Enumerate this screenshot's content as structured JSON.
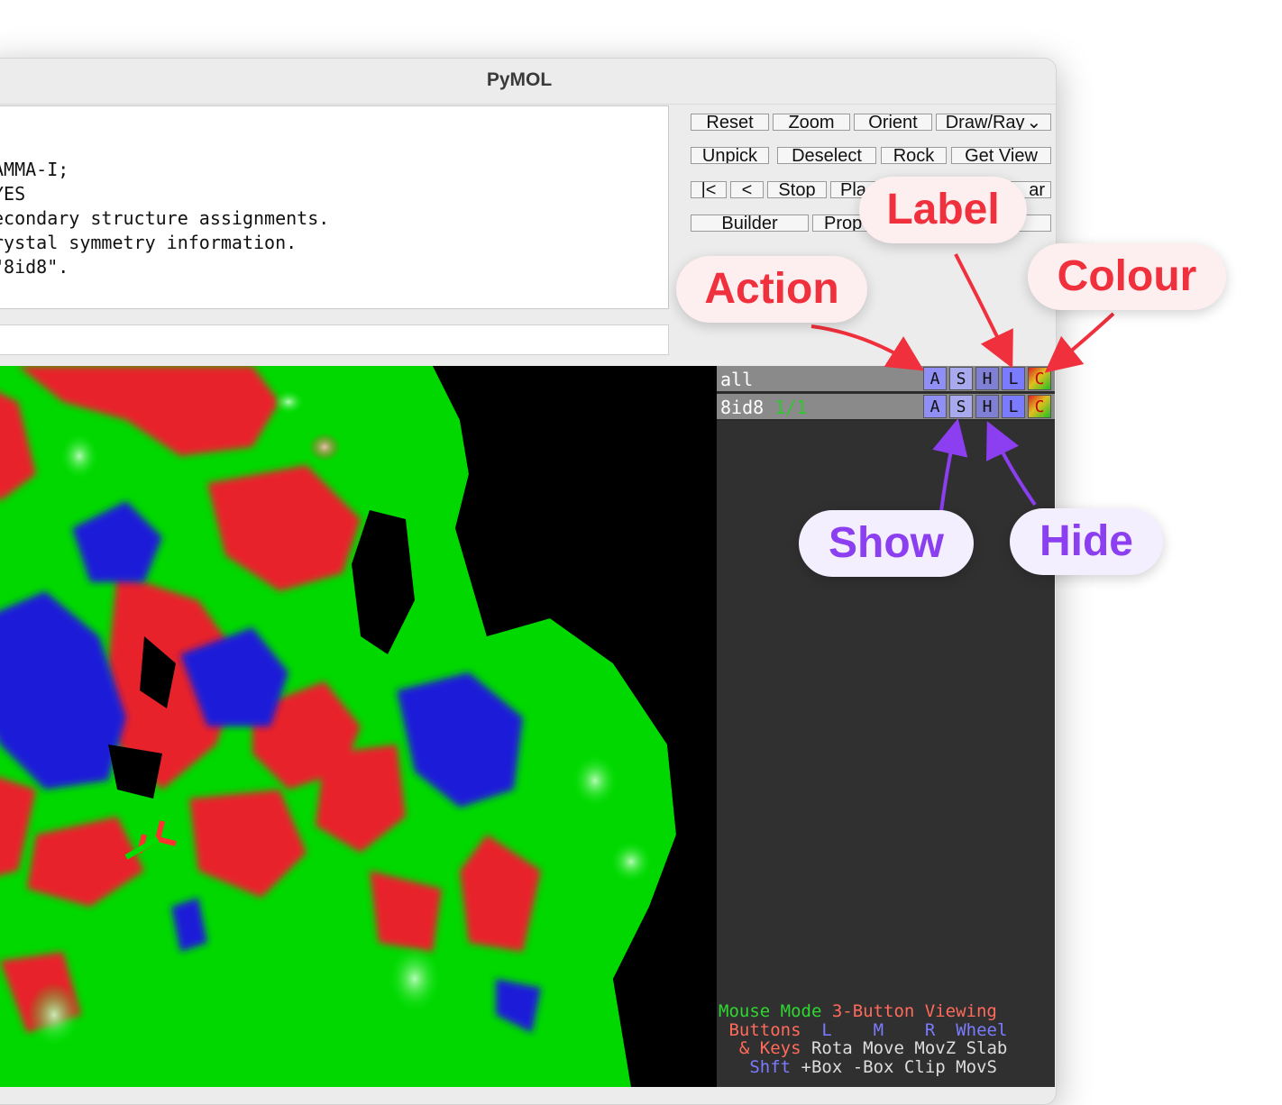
{
  "window": {
    "title": "PyMOL"
  },
  "output_lines": [
    "AMMA-I;",
    "YES",
    "econdary structure assignments.",
    "rystal symmetry information.",
    "\"8id8\"."
  ],
  "buttons": {
    "reset": "Reset",
    "zoom": "Zoom",
    "orient": "Orient",
    "draw_ray": "Draw/Ray",
    "unpick": "Unpick",
    "deselect": "Deselect",
    "rock": "Rock",
    "get_view": "Get View",
    "rewind": "|<",
    "back": "<",
    "stop": "Stop",
    "play": "Pla",
    "clear": "ar",
    "builder": "Builder",
    "properties": "Prop"
  },
  "objects": [
    {
      "name": "all",
      "state": ""
    },
    {
      "name": "8id8",
      "state": "1/1"
    }
  ],
  "object_buttons": [
    "A",
    "S",
    "H",
    "L",
    "C"
  ],
  "mouse_mode": {
    "title_a": "Mouse Mode",
    "title_b": "3-Button Viewing",
    "buttons_label": "Buttons",
    "col_l": "L",
    "col_m": "M",
    "col_r": "R",
    "col_wheel": "Wheel",
    "keys_label": "& Keys",
    "keys_values": "Rota Move MovZ Slab",
    "shft_label": "Shft",
    "shft_values": "+Box -Box Clip MovS"
  },
  "callouts": {
    "action": "Action",
    "label": "Label",
    "colour": "Colour",
    "show": "Show",
    "hide": "Hide"
  },
  "colors": {
    "callout_red": "#f0303c",
    "callout_purple": "#8b3ff0",
    "surface_green": "#00e000",
    "surface_red": "#e8202a",
    "surface_blue": "#1a1ad8"
  }
}
